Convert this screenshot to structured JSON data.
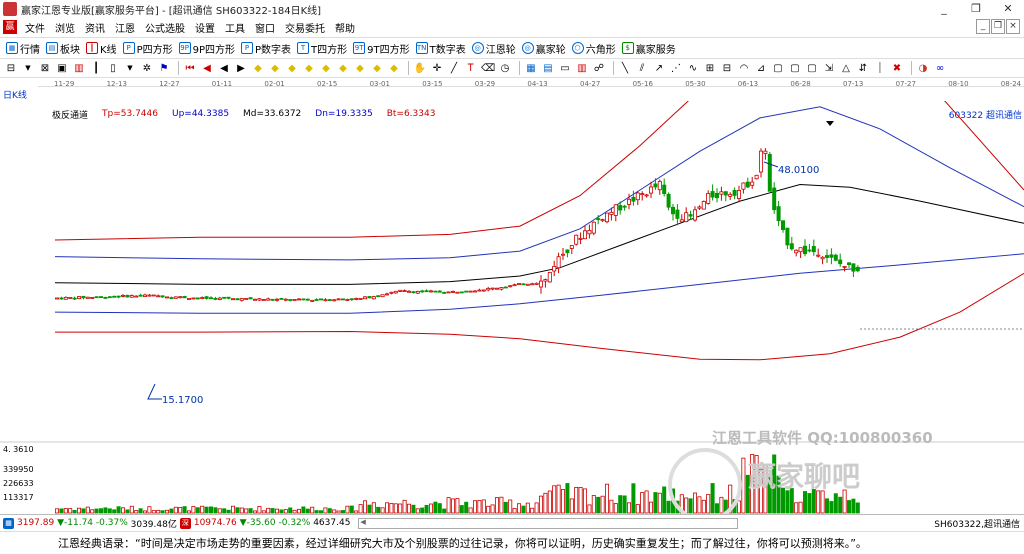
{
  "window": {
    "title": "赢家江恩专业版[赢家服务平台] - [超讯通信  SH603322-184日K线]",
    "controls": [
      "_",
      "❐",
      "✕"
    ]
  },
  "menu": {
    "items": [
      "文件",
      "浏览",
      "资讯",
      "江恩",
      "公式选股",
      "设置",
      "工具",
      "窗口",
      "交易委托",
      "帮助"
    ],
    "mdi": [
      "_",
      "❐",
      "×"
    ]
  },
  "toolbar1": {
    "items": [
      {
        "icon": "grid",
        "label": "行情"
      },
      {
        "icon": "block",
        "label": "板块"
      },
      {
        "icon": "kline",
        "label": "K线"
      },
      {
        "icon": "P",
        "label": "P四方形"
      },
      {
        "icon": "9P",
        "label": "9P四方形"
      },
      {
        "icon": "P",
        "label": "P数字表"
      },
      {
        "icon": "T",
        "label": "T四方形"
      },
      {
        "icon": "9T",
        "label": "9T四方形"
      },
      {
        "icon": "TN",
        "label": "T数字表"
      },
      {
        "icon": "wheel",
        "label": "江恩轮"
      },
      {
        "icon": "wheel",
        "label": "赢家轮"
      },
      {
        "icon": "hex",
        "label": "六角形"
      },
      {
        "icon": "dollar",
        "label": "赢家服务"
      }
    ]
  },
  "chart": {
    "period_label": "日K线",
    "date_ticks": [
      "11-29",
      "12-13",
      "12-27",
      "01-11",
      "02-01",
      "02-15",
      "03-01",
      "03-15",
      "03-29",
      "04-13",
      "04-27",
      "05-16",
      "05-30",
      "06-13",
      "06-28",
      "07-13",
      "07-27",
      "08-10",
      "08-24"
    ],
    "indicator": {
      "name": "极反通道",
      "tp": "Tp=53.7446",
      "up": "Up=44.3385",
      "md": "Md=33.6372",
      "dn": "Dn=19.3335",
      "bt": "Bt=6.3343"
    },
    "symbol_label": "603322  超讯通信",
    "high_label": "48.0100",
    "low_label": "15.1700",
    "colors": {
      "tp": "#cc0000",
      "up": "#2233bb",
      "md": "#000000",
      "dn": "#2233bb",
      "bt": "#cc0000",
      "up_candle": "#cc0000",
      "down_candle": "#009900"
    }
  },
  "volume": {
    "labels": [
      "4. 3610",
      "339950",
      "226633",
      "113317"
    ]
  },
  "watermark": {
    "line1": "江恩工具软件  QQ:100800360",
    "line2": "赢家聊吧"
  },
  "status": {
    "sh_value": "3197.89",
    "sh_change": "▼-11.74",
    "sh_pct": "-0.37%",
    "sh_amount": "3039.48亿",
    "sz_value": "10974.76",
    "sz_change": "▼-35.60",
    "sz_pct": "-0.32%",
    "sz_amount": "4637.45",
    "symbol": "SH603322,超讯通信"
  },
  "quote": "江恩经典语录：“时间是决定市场走势的重要因素，经过详细研究大市及个别股票的过往记录，你将可以证明，历史确实重复发生；而了解过往，你将可以预测将来。”。"
}
